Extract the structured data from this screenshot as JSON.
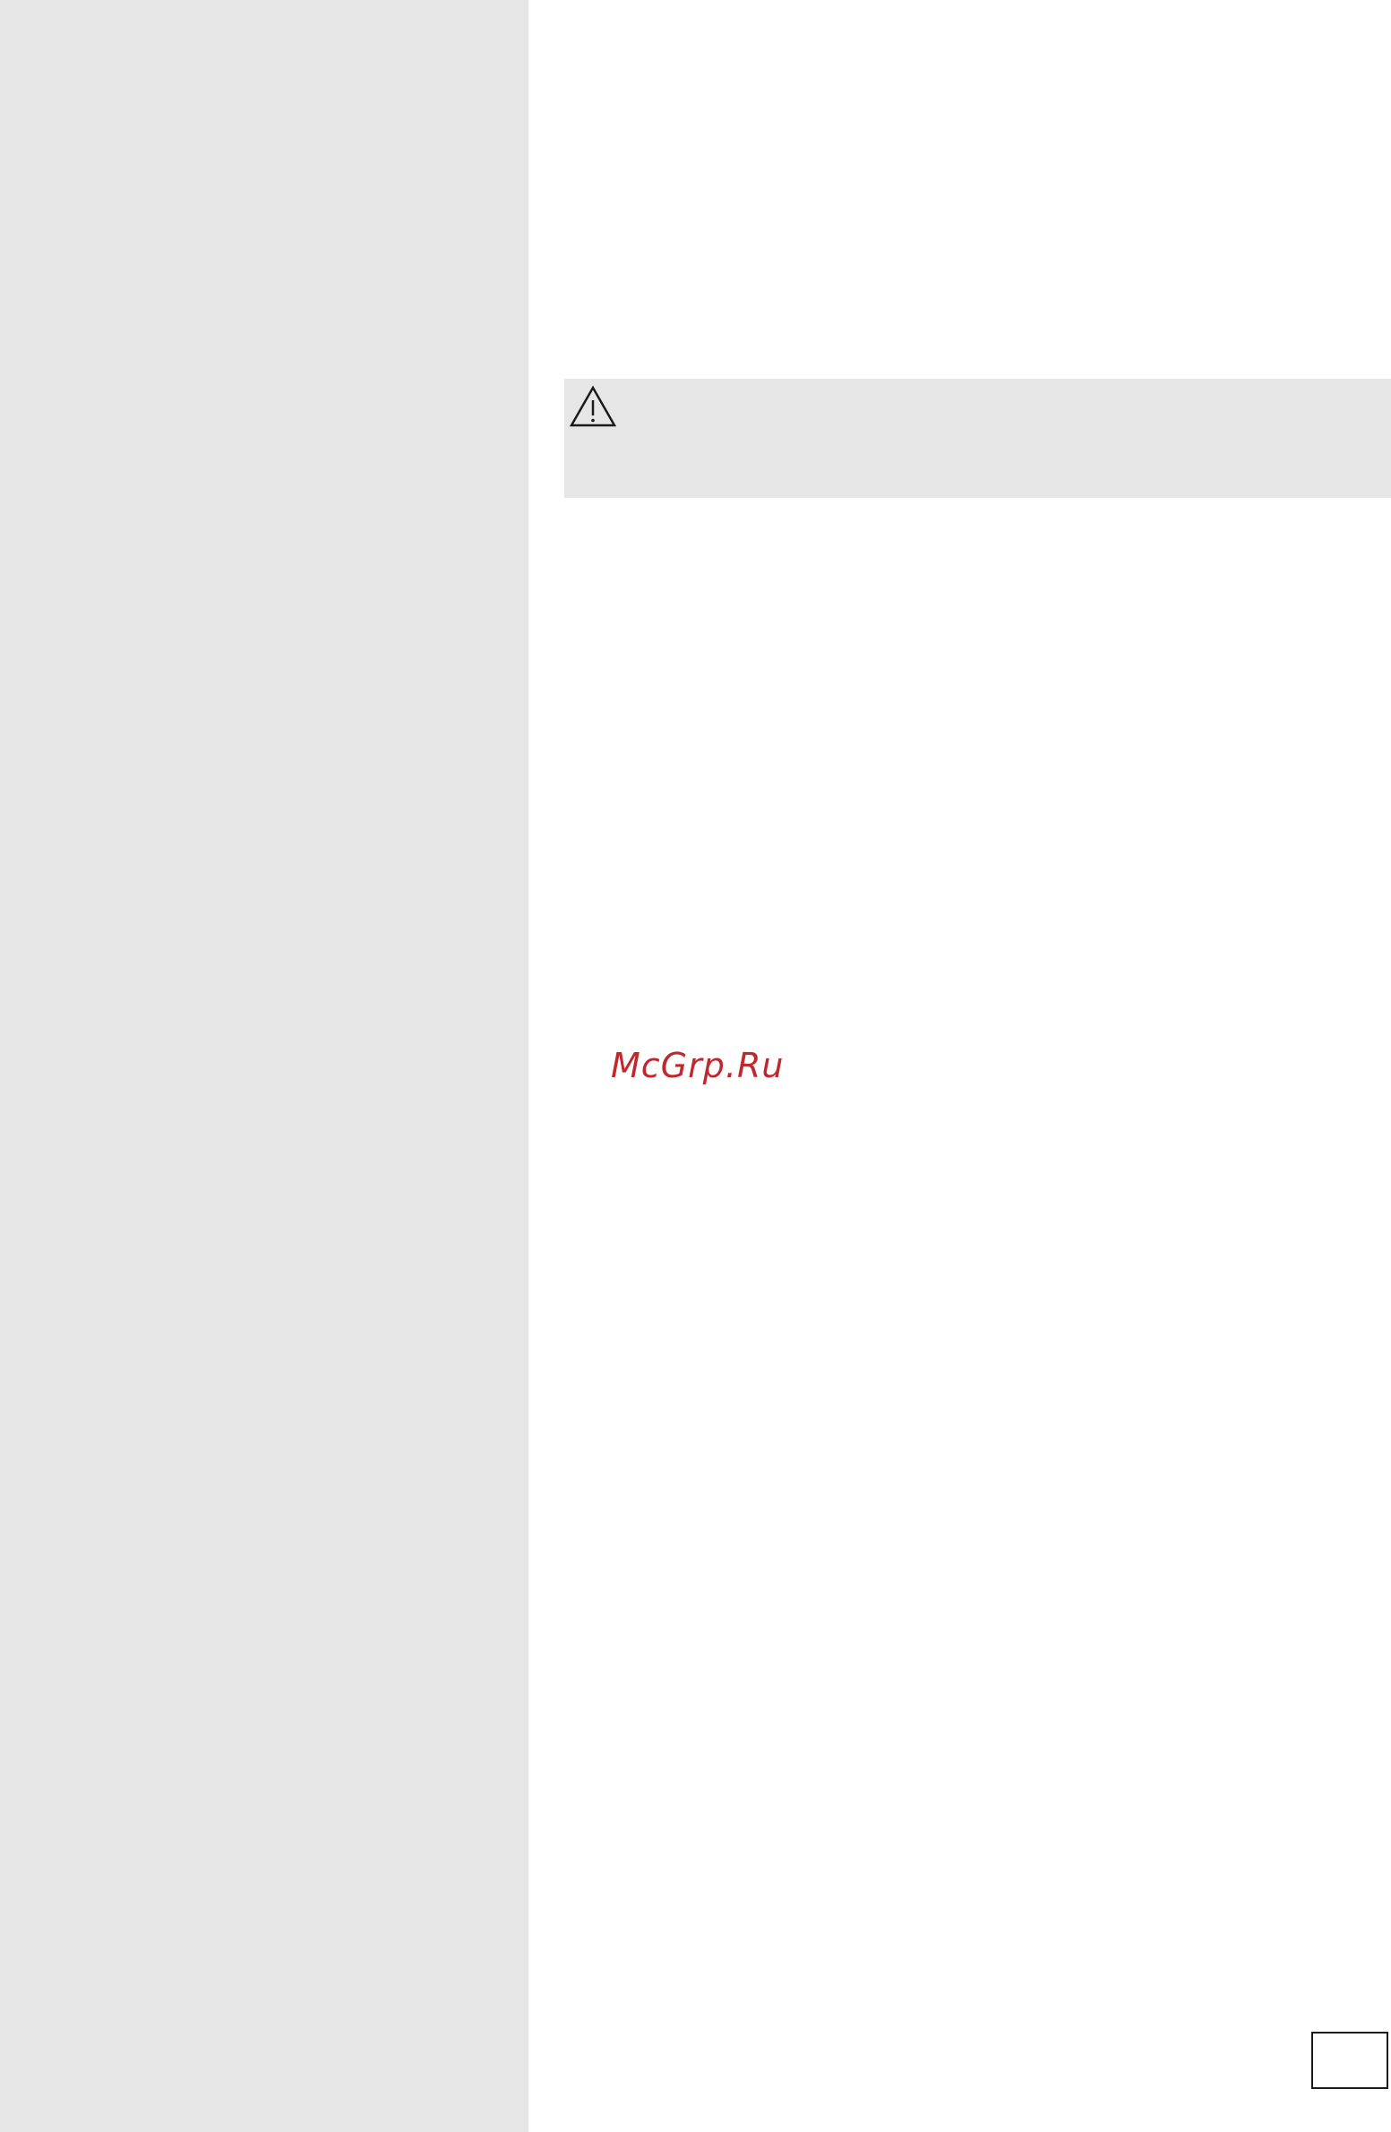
{
  "colors": {
    "side_column": "#e6e6e6",
    "warning_box": "#e6e6e6",
    "watermark": "#c0282d",
    "icon_stroke": "#1a1a1a"
  },
  "warning": {
    "icon": "warning-triangle-icon"
  },
  "watermark": {
    "text": "McGrp.Ru"
  },
  "page_number": ""
}
